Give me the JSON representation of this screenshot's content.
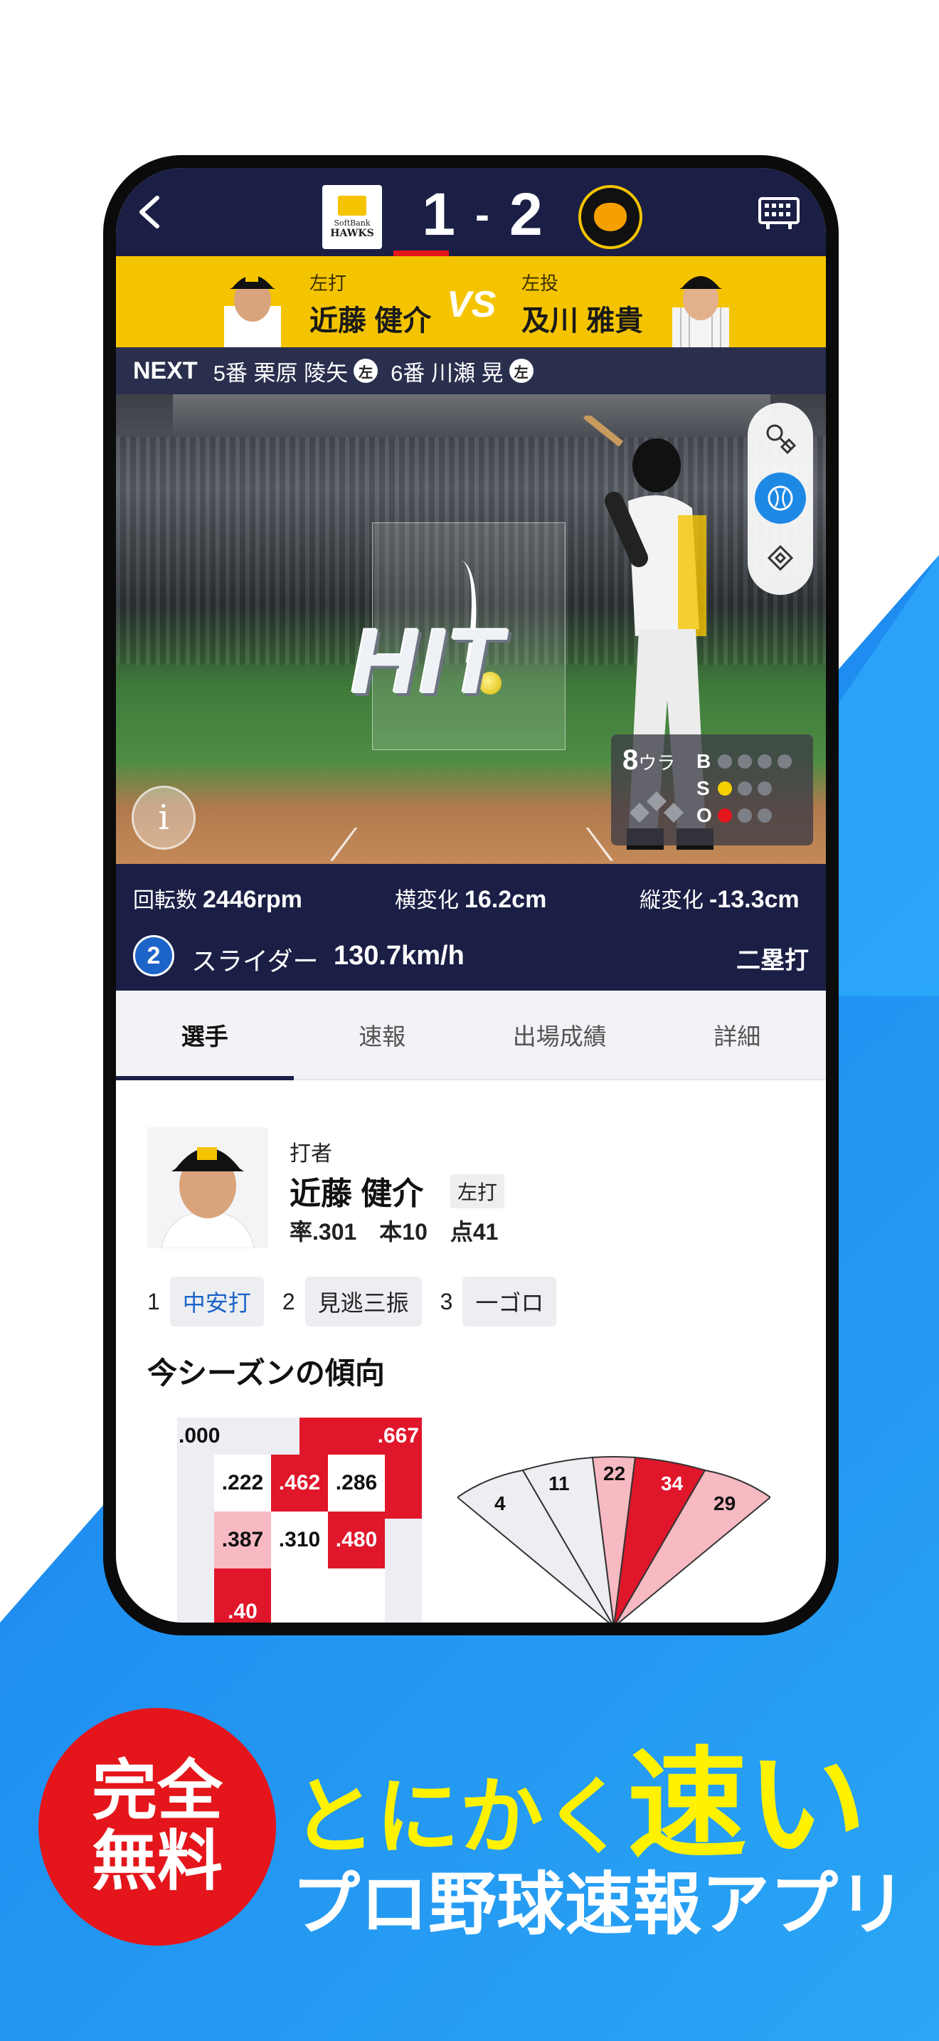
{
  "header": {
    "home_team_logo": "hawks-logo",
    "home_logo_line1": "SoftBank",
    "home_logo_line2": "HAWKS",
    "away_team_logo": "tigers-logo",
    "home_score": "1",
    "score_separator": "-",
    "away_score": "2"
  },
  "matchup": {
    "batter_hand": "左打",
    "batter_name": "近藤 健介",
    "vs_label": "VS",
    "pitcher_hand": "左投",
    "pitcher_name": "及川 雅貴"
  },
  "next_batters": {
    "label": "NEXT",
    "items": [
      {
        "text": "5番 栗原 陵矢",
        "hand": "左"
      },
      {
        "text": "6番 川瀬 晃",
        "hand": "左"
      }
    ]
  },
  "field": {
    "play_result_overlay": "HIT",
    "inning": "8",
    "inning_half": "ウラ",
    "count": {
      "balls": 0,
      "strikes": 1,
      "outs": 1
    },
    "count_labels": {
      "b": "B",
      "s": "S",
      "o": "O"
    },
    "colors": {
      "strike": "#f5d000",
      "out": "#e4161c",
      "off": "#7d7f86",
      "active_view": "#1e88e5"
    }
  },
  "pitch": {
    "spin_label": "回転数",
    "spin_value": "2446rpm",
    "hbreak_label": "横変化",
    "hbreak_value": "16.2cm",
    "vbreak_label": "縦変化",
    "vbreak_value": "-13.3cm",
    "pitch_number": "2",
    "pitch_type": "スライダー",
    "speed": "130.7km/h",
    "result": "二塁打"
  },
  "tabs": [
    {
      "label": "選手",
      "active": true
    },
    {
      "label": "速報",
      "active": false
    },
    {
      "label": "出場成績",
      "active": false
    },
    {
      "label": "詳細",
      "active": false
    }
  ],
  "player": {
    "role": "打者",
    "name": "近藤 健介",
    "hand": "左打",
    "stats": "率.301　本10　点41"
  },
  "at_bats": [
    {
      "num": "1",
      "result": "中安打",
      "hit": true
    },
    {
      "num": "2",
      "result": "見逃三振",
      "hit": false
    },
    {
      "num": "3",
      "result": "一ゴロ",
      "hit": false
    }
  ],
  "trend": {
    "title": "今シーズンの傾向",
    "zone": {
      "top_left": ".000",
      "top_right": ".667",
      "r1": [
        ".222",
        ".462",
        ".286"
      ],
      "r2": [
        ".387",
        ".310",
        ".480"
      ],
      "bottom": ".40"
    },
    "spray": [
      "4",
      "11",
      "22",
      "34",
      "29"
    ]
  },
  "promo": {
    "badge_line1": "完全",
    "badge_line2": "無料",
    "headline_prefix": "とにかく",
    "headline_emph": "速い",
    "subline": "プロ野球速報アプリ",
    "colors": {
      "badge": "#e4161c",
      "headline": "#fff200"
    }
  }
}
